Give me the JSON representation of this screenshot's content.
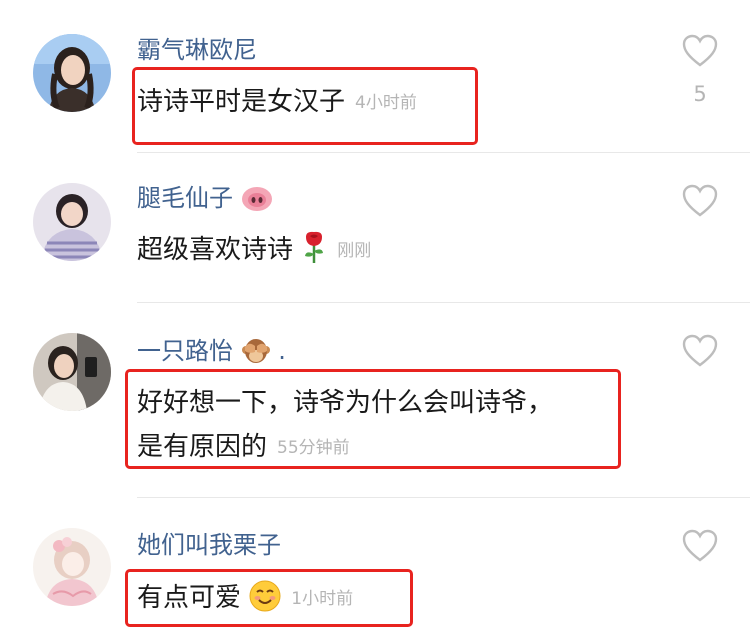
{
  "comments": [
    {
      "username": "霸气琳欧尼",
      "text": "诗诗平时是女汉子",
      "time": "4小时前",
      "likes": "5",
      "avatar_icon": "avatar-woman-sky"
    },
    {
      "username": "腿毛仙子",
      "text": "超级喜欢诗诗",
      "time": "刚刚",
      "likes": "",
      "avatar_icon": "avatar-woman-striped",
      "username_emoji": "pig-nose-icon",
      "text_emoji": "rose-icon"
    },
    {
      "username": "一只路怡",
      "username_suffix": ".",
      "text_line1": "好好想一下，诗爷为什么会叫诗爷，",
      "text_line2": "是有原因的",
      "time": "55分钟前",
      "likes": "",
      "avatar_icon": "avatar-mirror-selfie",
      "username_emoji": "see-no-evil-monkey-icon"
    },
    {
      "username": "她们叫我栗子",
      "text": "有点可爱",
      "time": "1小时前",
      "likes": "",
      "avatar_icon": "avatar-anime-girl",
      "text_emoji": "smiling-face-icon"
    }
  ],
  "colors": {
    "username": "#41628f",
    "text": "#1a1a1a",
    "meta": "#b5b5b5",
    "highlight": "#e8231f",
    "divider": "#e8e8e8"
  }
}
